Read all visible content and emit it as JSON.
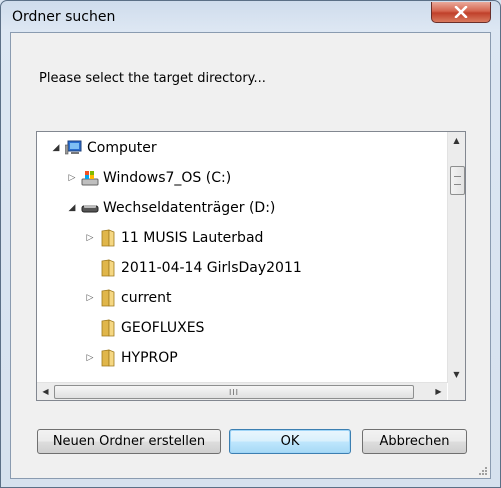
{
  "window": {
    "title": "Ordner suchen"
  },
  "prompt": "Please select the target directory...",
  "tree": {
    "items": [
      {
        "label": "Computer",
        "icon": "computer-icon",
        "expander": "expanded"
      },
      {
        "label": "Windows7_OS (C:)",
        "icon": "drive-icon",
        "expander": "collapsed"
      },
      {
        "label": "Wechseldatenträger (D:)",
        "icon": "removable-drive-icon",
        "expander": "expanded"
      },
      {
        "label": "11 MUSIS Lauterbad",
        "icon": "folder-icon",
        "expander": "collapsed"
      },
      {
        "label": "2011-04-14 GirlsDay2011",
        "icon": "folder-icon",
        "expander": "none"
      },
      {
        "label": "current",
        "icon": "folder-icon",
        "expander": "collapsed"
      },
      {
        "label": "GEOFLUXES",
        "icon": "folder-icon",
        "expander": "none"
      },
      {
        "label": "HYPROP",
        "icon": "folder-icon",
        "expander": "collapsed"
      }
    ],
    "hscroll_thumb_label": "III"
  },
  "buttons": {
    "new_folder": "Neuen Ordner erstellen",
    "ok": "OK",
    "cancel": "Abbrechen"
  },
  "colors": {
    "close_button": "#c7442d",
    "default_button_border": "#3c7fb1",
    "window_frame": "#cfdcec"
  }
}
